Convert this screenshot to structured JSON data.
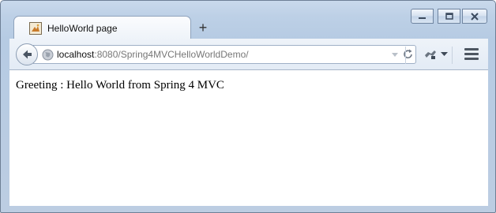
{
  "window": {
    "tab_title": "HelloWorld page",
    "new_tab_symbol": "+",
    "controls": [
      "minimize",
      "maximize",
      "close"
    ]
  },
  "toolbar": {
    "url": {
      "host": "localhost",
      "rest": ":8080/Spring4MVCHelloWorldDemo/"
    },
    "icons": [
      "back-arrow-icon",
      "globe-icon",
      "dropdown-arrow-icon",
      "reload-icon",
      "addon-icon",
      "menu-icon"
    ]
  },
  "page": {
    "greeting": "Greeting : Hello World from Spring 4 MVC"
  },
  "colors": {
    "window_frame": "#bdd0e6",
    "toolbar": "#e9eff7",
    "content": "#ffffff"
  }
}
